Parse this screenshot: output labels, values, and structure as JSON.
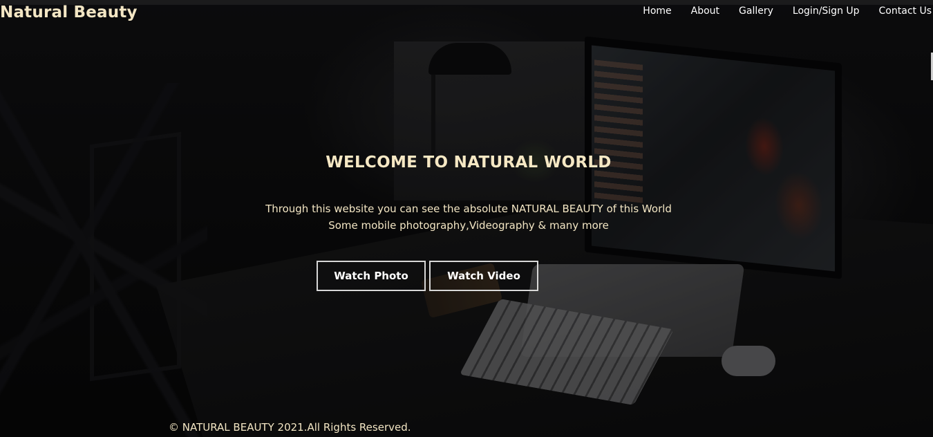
{
  "header": {
    "brand": "Natural Beauty",
    "nav": [
      {
        "label": "Home"
      },
      {
        "label": "About"
      },
      {
        "label": "Gallery"
      },
      {
        "label": "Login/Sign Up"
      },
      {
        "label": "Contact Us"
      }
    ]
  },
  "hero": {
    "title": "WELCOME TO NATURAL WORLD",
    "line1": "Through this website you can see the absolute NATURAL BEAUTY of this World",
    "line2": "Some mobile photography,Videography & many more",
    "buttons": [
      {
        "label": "Watch Photo"
      },
      {
        "label": "Watch Video"
      }
    ]
  },
  "footer": {
    "text": "© NATURAL BEAUTY 2021.All Rights Reserved."
  },
  "colors": {
    "text_cream": "#f3e6c4",
    "nav_white": "#ffffff",
    "button_border": "#d8d8d8",
    "background": "#0b0b0c"
  }
}
